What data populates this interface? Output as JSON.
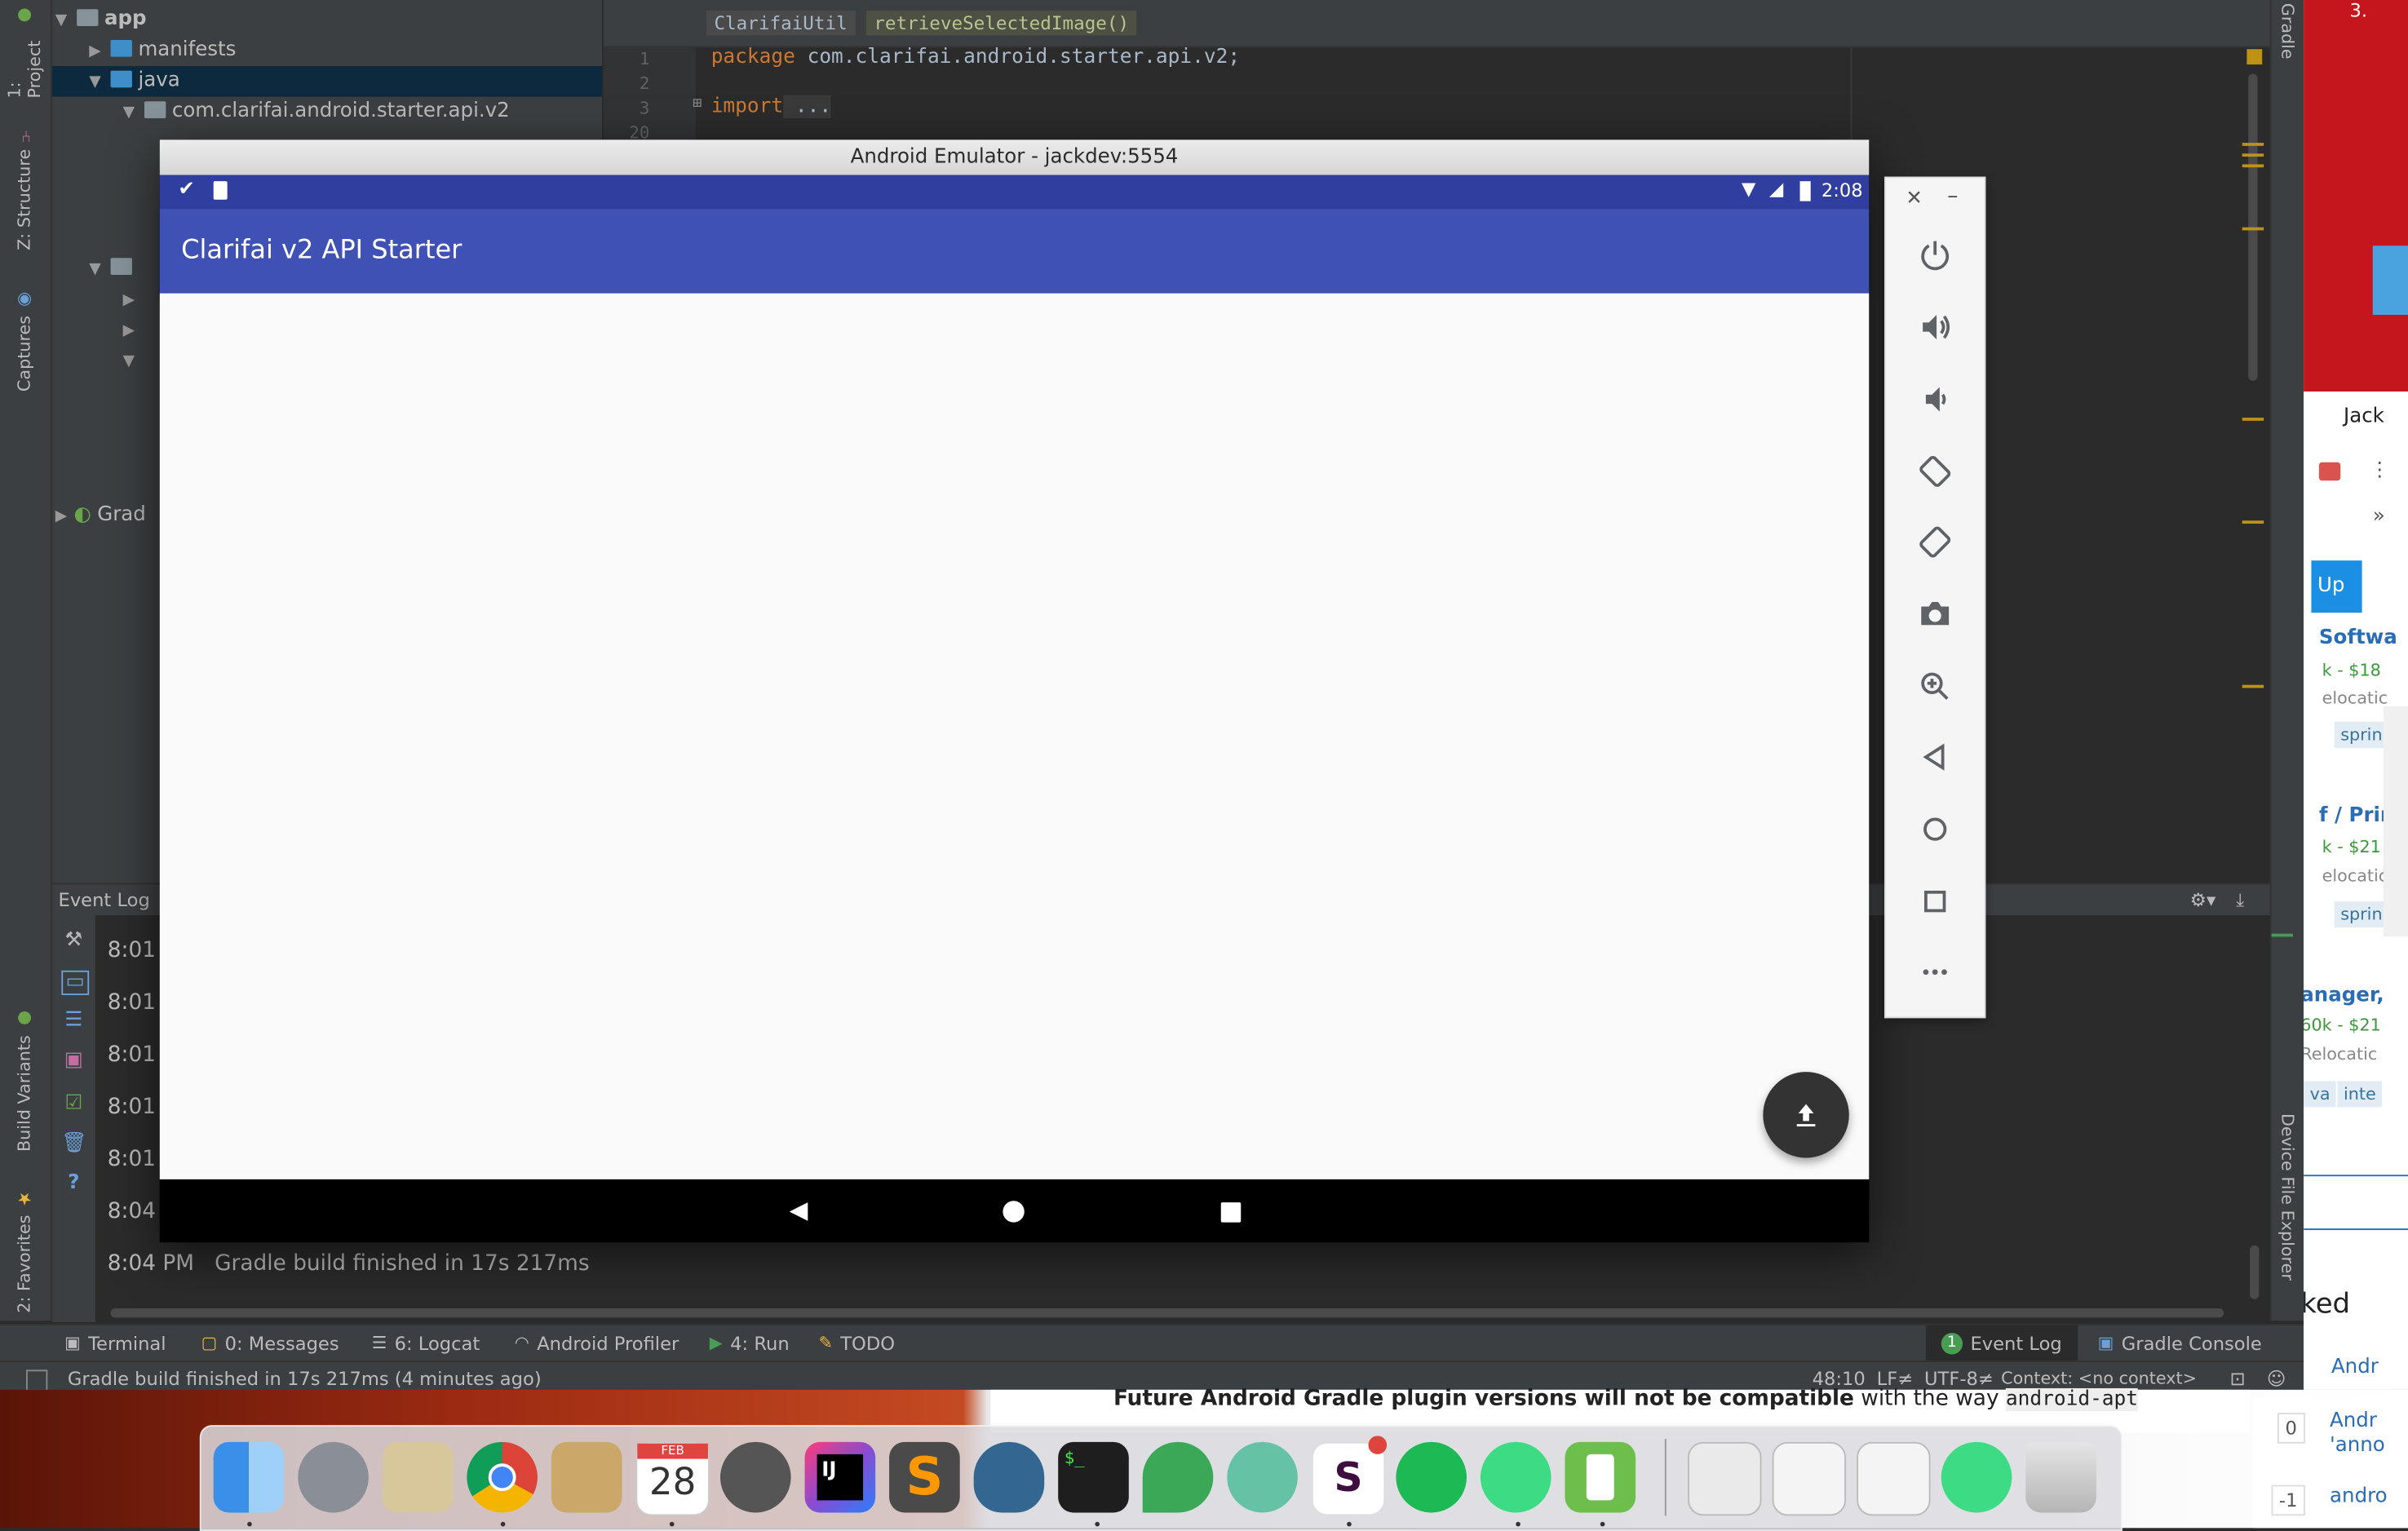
{
  "ide": {
    "left_tabs": [
      "1: Project",
      "Z: Structure",
      "Captures",
      "Build Variants",
      "2: Favorites"
    ],
    "right_tabs": [
      "Gradle",
      "Device File Explorer"
    ],
    "project_tree": [
      {
        "label": "app"
      },
      {
        "label": "manifests"
      },
      {
        "label": "java"
      },
      {
        "label": "com.clarifai.android.starter.api.v2"
      },
      {
        "label": "Grad"
      }
    ],
    "breadcrumbs": [
      "ClarifaiUtil",
      "retrieveSelectedImage()"
    ],
    "code_lines": [
      {
        "num": "1",
        "kw": "package",
        "text": " com.clarifai.android.starter.api.v2;"
      },
      {
        "num": "2",
        "kw": "",
        "text": ""
      },
      {
        "num": "3",
        "kw": "import",
        "text": " ..."
      },
      {
        "num": "20",
        "kw": "",
        "text": ""
      }
    ],
    "event_log": {
      "title": "Event Log",
      "rows": [
        "8:01",
        "8:01",
        "8:01",
        "8:01",
        "8:01",
        "8:04",
        "8:04 PM   Gradle build finished in 17s 217ms"
      ]
    },
    "bottom_tabs": {
      "terminal": "Terminal",
      "messages": "0: Messages",
      "logcat": "6: Logcat",
      "profiler": "Android Profiler",
      "run": "4: Run",
      "todo": "TODO",
      "event_log": "Event Log",
      "event_log_count": "1",
      "gradle_console": "Gradle Console"
    },
    "status_bar": {
      "message": "Gradle build finished in 17s 217ms (4 minutes ago)",
      "position": "48:10",
      "line_sep": "LF≠",
      "encoding": "UTF-8≠",
      "context": "Context: <no context>"
    }
  },
  "emulator": {
    "window_title": "Android Emulator - jackdev:5554",
    "time": "2:08",
    "app_title": "Clarifai v2 API Starter",
    "fab_icon": "upload-icon",
    "controls": [
      "power-icon",
      "volume-up-icon",
      "volume-down-icon",
      "rotate-left-icon",
      "rotate-right-icon",
      "camera-icon",
      "zoom-icon",
      "back-icon",
      "home-icon",
      "overview-icon",
      "more-icon"
    ]
  },
  "browser": {
    "items": [
      "Jack",
      "»",
      "Up",
      "Softwa",
      "k - $18",
      "elocatic",
      "sprin",
      "f / Prin",
      "k - $21",
      "elocatic",
      "sprin",
      "anager,",
      "60k - $21",
      "Relocatic",
      "va",
      "inte",
      "ked",
      "Andr",
      "0",
      "Andr",
      "'anno",
      "-1",
      "andro",
      "3."
    ]
  },
  "document_snippet": {
    "bold": "Future Android Gradle plugin versions will not be compatible",
    "rest": " with the way ",
    "code": "android-apt"
  },
  "dock": {
    "calendar_month": "FEB",
    "calendar_day": "28",
    "ij_label": "IJ",
    "terminal_label": "$_",
    "slack_label": "S"
  }
}
